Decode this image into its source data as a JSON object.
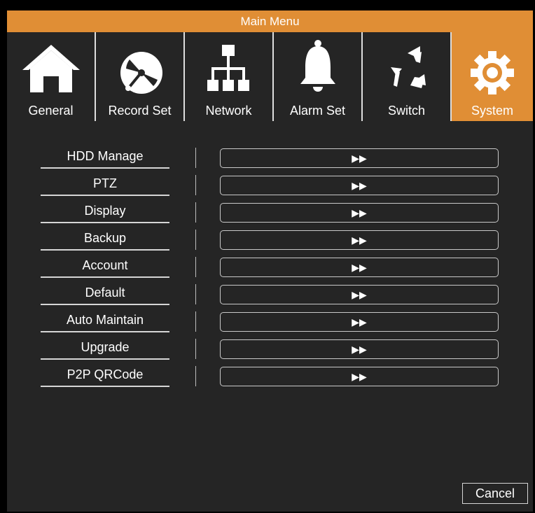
{
  "window": {
    "title": "Main Menu"
  },
  "tabs": [
    {
      "label": "General",
      "icon": "home-icon",
      "active": false
    },
    {
      "label": "Record Set",
      "icon": "disc-icon",
      "active": false
    },
    {
      "label": "Network",
      "icon": "network-icon",
      "active": false
    },
    {
      "label": "Alarm Set",
      "icon": "bell-icon",
      "active": false
    },
    {
      "label": "Switch",
      "icon": "switch-arrows-icon",
      "active": false
    },
    {
      "label": "System",
      "icon": "gear-icon",
      "active": true
    }
  ],
  "menu": {
    "items": [
      {
        "label": "HDD Manage",
        "action": "▶▶"
      },
      {
        "label": "PTZ",
        "action": "▶▶"
      },
      {
        "label": "Display",
        "action": "▶▶"
      },
      {
        "label": "Backup",
        "action": "▶▶"
      },
      {
        "label": "Account",
        "action": "▶▶"
      },
      {
        "label": "Default",
        "action": "▶▶"
      },
      {
        "label": "Auto Maintain",
        "action": "▶▶"
      },
      {
        "label": "Upgrade",
        "action": "▶▶"
      },
      {
        "label": "P2P QRCode",
        "action": "▶▶"
      }
    ]
  },
  "footer": {
    "cancel_label": "Cancel"
  },
  "colors": {
    "accent": "#e08e35",
    "background": "#252525",
    "text": "#ffffff"
  }
}
